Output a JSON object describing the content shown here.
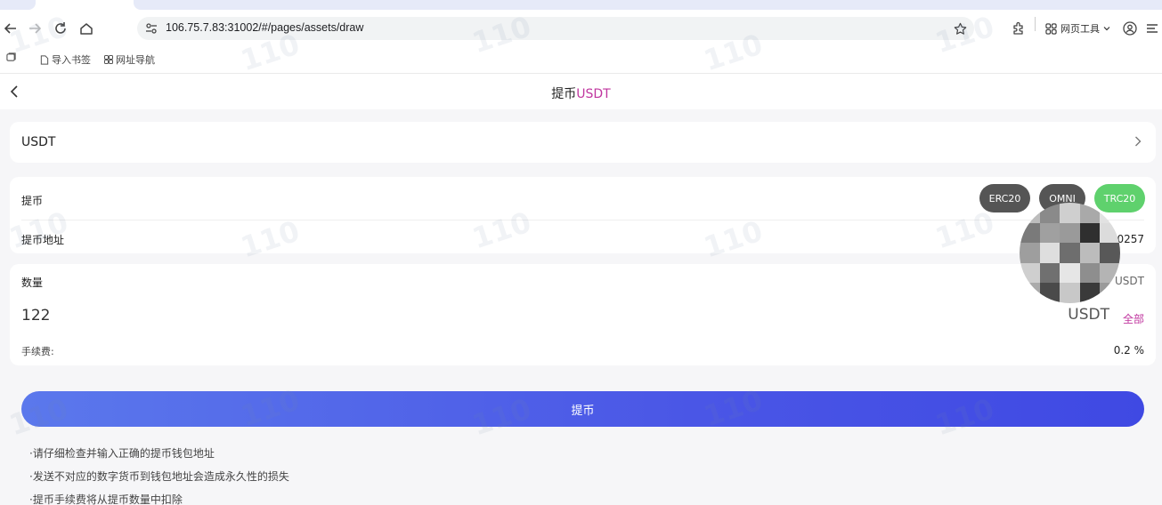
{
  "browser": {
    "url": "106.75.7.83:31002/#/pages/assets/draw",
    "web_tools_label": "网页工具",
    "bookmarks": [
      {
        "label": "导入书签"
      },
      {
        "label": "网址导航"
      }
    ]
  },
  "nav": {
    "title_prefix": "提币",
    "title_coin": "USDT"
  },
  "coin_select": {
    "label": "USDT"
  },
  "chain": {
    "label": "提币",
    "options": [
      {
        "label": "ERC20",
        "selected": false
      },
      {
        "label": "OMNI",
        "selected": false
      },
      {
        "label": "TRC20",
        "selected": true
      }
    ],
    "address_label": "提币地址",
    "address_value_tail": "0257"
  },
  "amount": {
    "label": "数量",
    "available_unit": "USDT",
    "value": "122",
    "unit": "USDT",
    "all_label": "全部",
    "fee_label": "手续费:",
    "fee_value": "0.2 %"
  },
  "submit_label": "提币",
  "notes": [
    "·请仔细检查并输入正确的提币钱包地址",
    "·发送不对应的数字货币到钱包地址会造成永久性的损失",
    "·提币手续费将从提币数量中扣除"
  ],
  "colors": {
    "accent": "#c0369f",
    "chip_dark": "#555555",
    "chip_selected": "#5fd16d",
    "button_start": "#5b78ec",
    "button_end": "#3f49e3"
  }
}
